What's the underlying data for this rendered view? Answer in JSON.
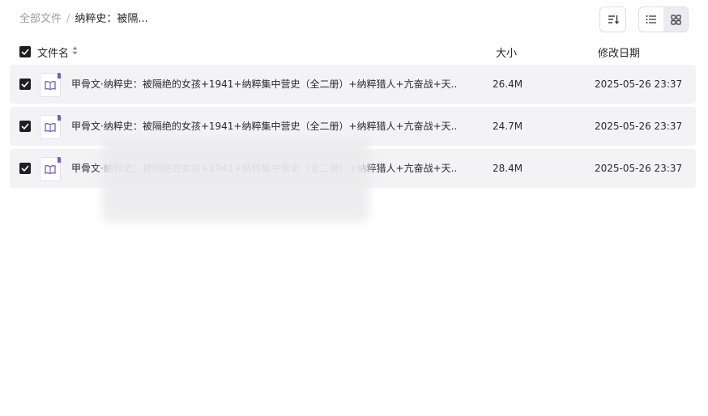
{
  "breadcrumb": {
    "root": "全部文件",
    "separator": "/",
    "current": "纳粹史：被隔..."
  },
  "toolbar": {
    "sort_icon": "sort-lines-icon",
    "list_view_icon": "list-icon",
    "grid_view_icon": "grid-icon",
    "active_view": "list"
  },
  "table": {
    "headers": {
      "name": "文件名",
      "size": "大小",
      "modified": "修改日期"
    },
    "rows": [
      {
        "name": "甲骨文·纳粹史：被隔绝的女孩+1941+纳粹集中营史（全二册）+纳粹猎人+亢奋战+天...",
        "size": "26.4M",
        "modified": "2025-05-26 23:37",
        "checked": true
      },
      {
        "name": "甲骨文·纳粹史：被隔绝的女孩+1941+纳粹集中营史（全二册）+纳粹猎人+亢奋战+天...",
        "size": "24.7M",
        "modified": "2025-05-26 23:37",
        "checked": true
      },
      {
        "name": "甲骨文·纳粹史：被隔绝的女孩+1941+纳粹集中营史（全二册）+纳粹猎人+亢奋战+天...",
        "size": "28.4M",
        "modified": "2025-05-26 23:37",
        "checked": true
      }
    ]
  },
  "colors": {
    "accent": "#6f5bd6",
    "row_bg": "#f3f3f5",
    "checkbox": "#1f1f22"
  }
}
